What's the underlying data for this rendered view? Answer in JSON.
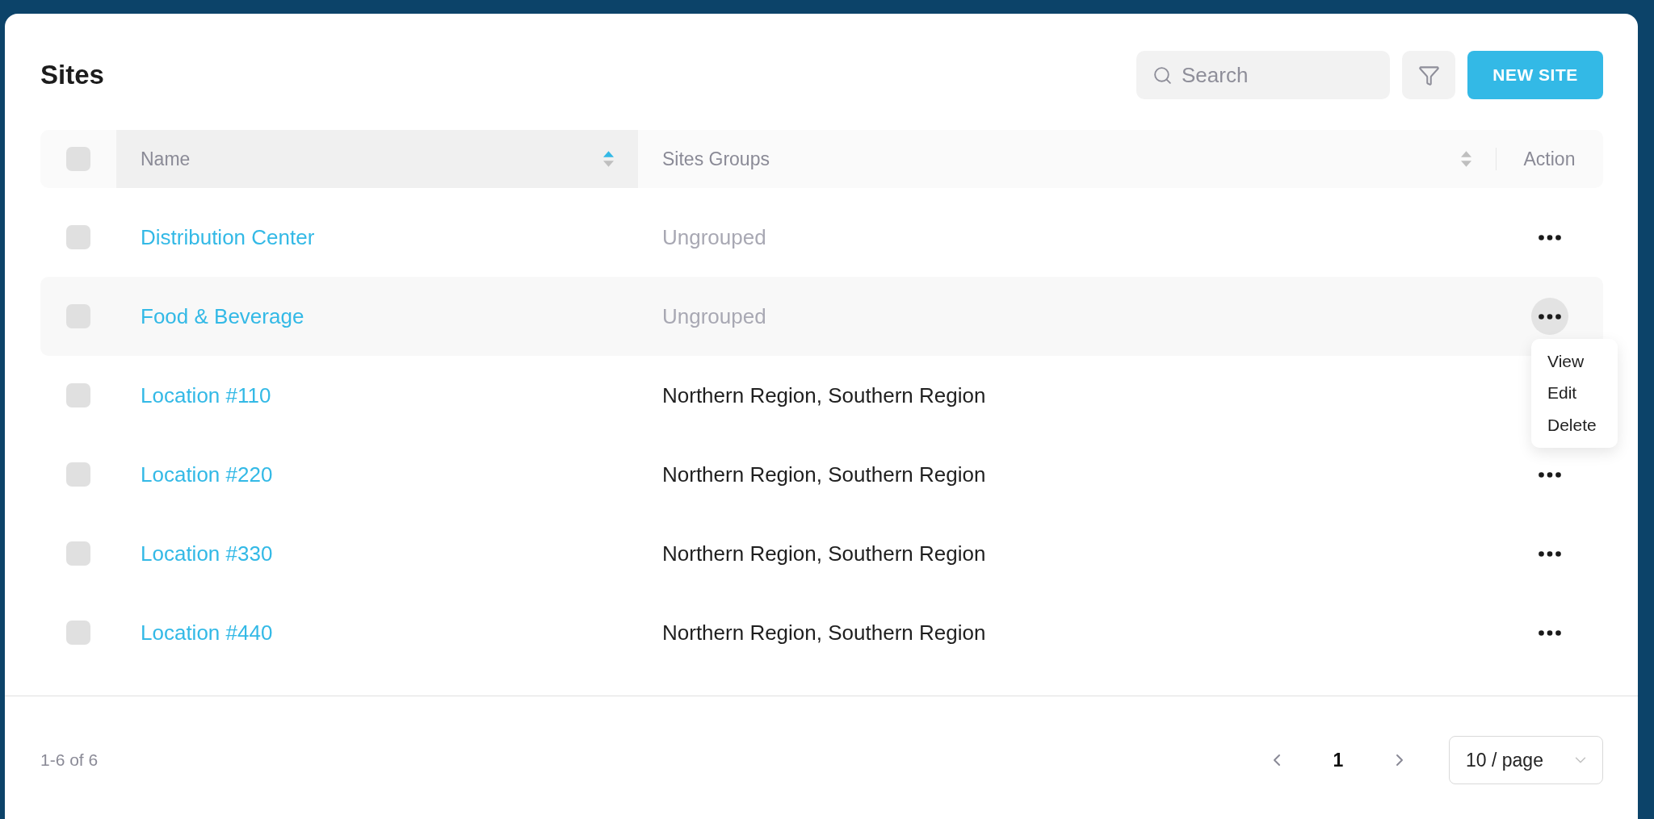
{
  "page": {
    "title": "Sites"
  },
  "toolbar": {
    "search": {
      "placeholder": "Search"
    },
    "new_button": "NEW SITE"
  },
  "table": {
    "select_all": {
      "checked": false
    },
    "columns": [
      {
        "label": "Name",
        "sortable": true,
        "sorted": true
      },
      {
        "label": "Sites Groups",
        "sortable": true,
        "sorted": false
      },
      {
        "label": "Action",
        "sortable": false
      }
    ],
    "rows": [
      {
        "name": "Distribution Center",
        "groups": "Ungrouped",
        "grouped": false,
        "checked": false,
        "menu_open": false
      },
      {
        "name": "Food & Beverage",
        "groups": "Ungrouped",
        "grouped": false,
        "checked": false,
        "menu_open": true
      },
      {
        "name": "Location #110",
        "groups": "Northern Region, Southern Region",
        "grouped": true,
        "checked": false,
        "menu_open": false
      },
      {
        "name": "Location #220",
        "groups": "Northern Region, Southern Region",
        "grouped": true,
        "checked": false,
        "menu_open": false
      },
      {
        "name": "Location #330",
        "groups": "Northern Region, Southern Region",
        "grouped": true,
        "checked": false,
        "menu_open": false
      },
      {
        "name": "Location #440",
        "groups": "Northern Region, Southern Region",
        "grouped": true,
        "checked": false,
        "menu_open": false
      }
    ],
    "action_menu": [
      "View",
      "Edit",
      "Delete"
    ]
  },
  "pagination": {
    "total": "1-6 of 6",
    "pages": [
      {
        "label": "1",
        "selected": true
      }
    ],
    "page_size": "10 / page"
  }
}
